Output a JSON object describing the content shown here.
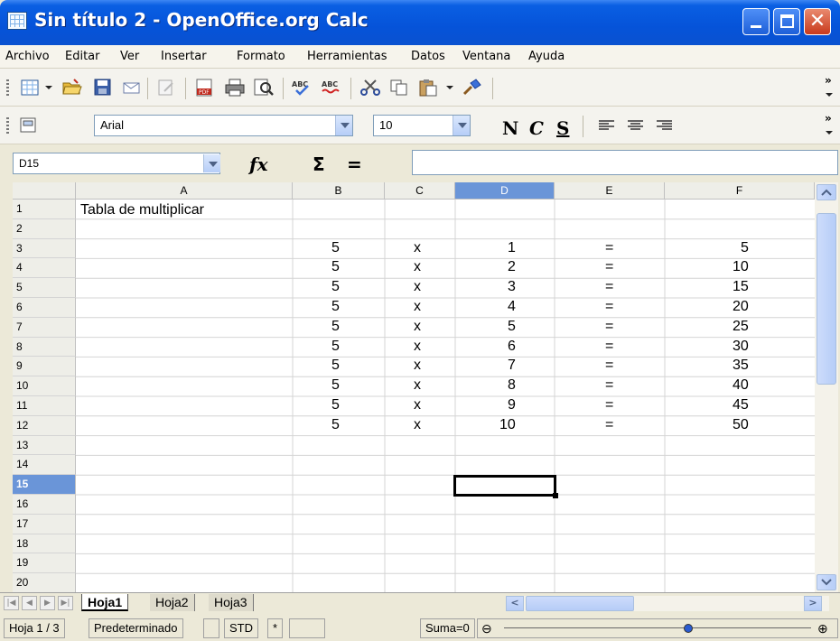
{
  "window": {
    "title": "Sin título 2 - OpenOffice.org Calc",
    "close_glyph": "✕"
  },
  "menu": [
    "Archivo",
    "Editar",
    "Ver",
    "Insertar",
    "Formato",
    "Herramientas",
    "Datos",
    "Ventana",
    "Ayuda"
  ],
  "toolbar": {
    "font_name": "Arial",
    "font_size": "10",
    "bold_label": "N",
    "italic_label": "C",
    "underline_label": "S",
    "overflow": "»"
  },
  "formula_bar": {
    "name_box": "D15",
    "fx_label": "fx",
    "sum_label": "Σ",
    "equals_label": "=",
    "content": ""
  },
  "sheet": {
    "columns": [
      "A",
      "B",
      "C",
      "D",
      "E",
      "F"
    ],
    "active_column": "D",
    "rows": [
      "1",
      "2",
      "3",
      "4",
      "5",
      "6",
      "7",
      "8",
      "9",
      "10",
      "11",
      "12",
      "13",
      "14",
      "15",
      "16",
      "17",
      "18",
      "19",
      "20"
    ],
    "active_row": "15",
    "title_cell": "Tabla de multiplicar",
    "table": [
      [
        "5",
        "x",
        "1",
        "=",
        "5"
      ],
      [
        "5",
        "x",
        "2",
        "=",
        "10"
      ],
      [
        "5",
        "x",
        "3",
        "=",
        "15"
      ],
      [
        "5",
        "x",
        "4",
        "=",
        "20"
      ],
      [
        "5",
        "x",
        "5",
        "=",
        "25"
      ],
      [
        "5",
        "x",
        "6",
        "=",
        "30"
      ],
      [
        "5",
        "x",
        "7",
        "=",
        "35"
      ],
      [
        "5",
        "x",
        "8",
        "=",
        "40"
      ],
      [
        "5",
        "x",
        "9",
        "=",
        "45"
      ],
      [
        "5",
        "x",
        "10",
        "=",
        "50"
      ]
    ],
    "tabs": [
      "Hoja1",
      "Hoja2",
      "Hoja3"
    ],
    "active_tab": "Hoja1"
  },
  "status": {
    "sheet_info": "Hoja 1 / 3",
    "page_style": "Predeterminado",
    "mode": "STD",
    "modified": "*",
    "sum": "Suma=0",
    "zoom_minus": "⊖",
    "zoom_plus": "⊕"
  },
  "colors": {
    "title_bar": "#0553d9",
    "active_header": "#6a95d8",
    "close_button": "#c8391c"
  }
}
